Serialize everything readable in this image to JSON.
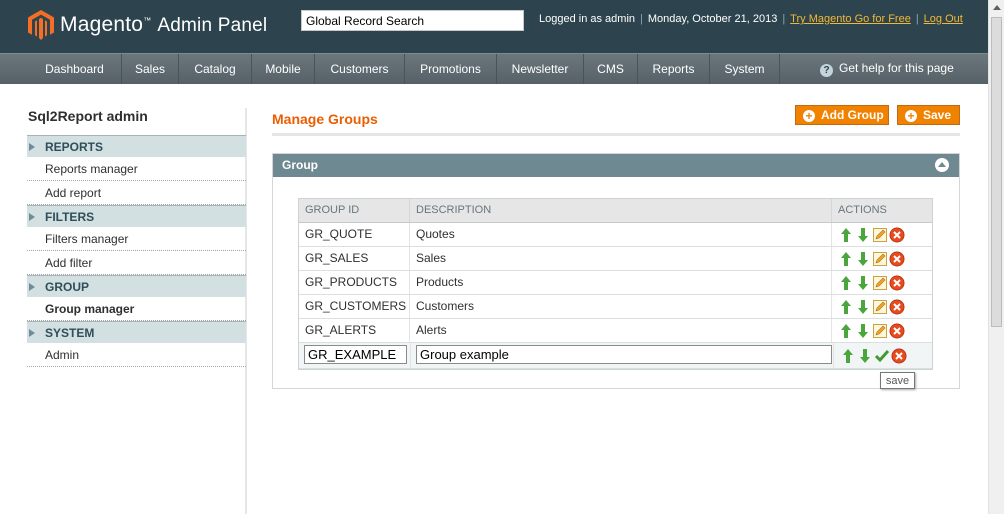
{
  "header": {
    "logo_brand": "Magento",
    "logo_suffix": "Admin Panel",
    "search_value": "Global Record Search",
    "logged_in": "Logged in as admin",
    "date": "Monday, October 21, 2013",
    "try_link": "Try Magento Go for Free",
    "logout": "Log Out"
  },
  "nav": {
    "items": [
      "Dashboard",
      "Sales",
      "Catalog",
      "Mobile",
      "Customers",
      "Promotions",
      "Newsletter",
      "CMS",
      "Reports",
      "System"
    ],
    "help": "Get help for this page"
  },
  "sidebar": {
    "title": "Sql2Report admin",
    "sections": [
      {
        "label": "REPORTS",
        "items": [
          "Reports manager",
          "Add report"
        ]
      },
      {
        "label": "FILTERS",
        "items": [
          "Filters manager",
          "Add filter"
        ]
      },
      {
        "label": "GROUP",
        "items": [
          "Group manager"
        ]
      },
      {
        "label": "SYSTEM",
        "items": [
          "Admin"
        ]
      }
    ]
  },
  "main": {
    "title": "Manage Groups",
    "add_button": "Add Group",
    "save_button": "Save",
    "box_title": "Group",
    "columns": [
      "GROUP ID",
      "DESCRIPTION",
      "ACTIONS"
    ],
    "rows": [
      {
        "id": "GR_QUOTE",
        "desc": "Quotes"
      },
      {
        "id": "GR_SALES",
        "desc": "Sales"
      },
      {
        "id": "GR_PRODUCTS",
        "desc": "Products"
      },
      {
        "id": "GR_CUSTOMERS",
        "desc": "Customers"
      },
      {
        "id": "GR_ALERTS",
        "desc": "Alerts"
      }
    ],
    "edit_row": {
      "id": "GR_EXAMPLE",
      "desc": "Group example"
    },
    "tooltip": "save"
  },
  "colors": {
    "header_bg": "#2d444f",
    "accent": "#eb5e00",
    "button": "#f18200",
    "box_head": "#6f8992"
  }
}
